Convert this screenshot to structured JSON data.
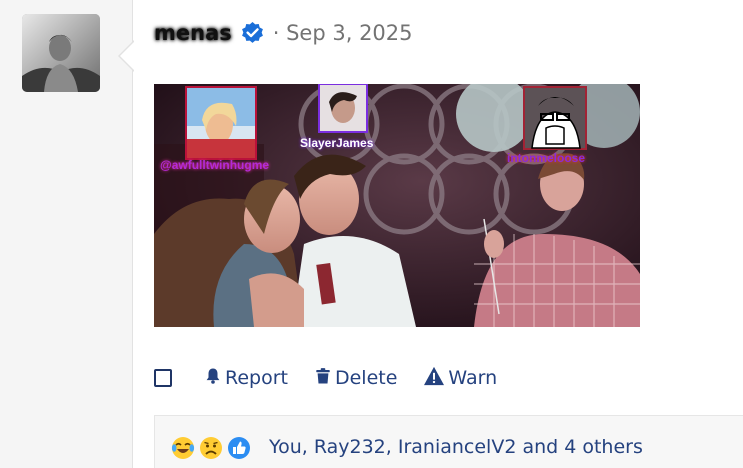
{
  "post": {
    "username": "menas",
    "date": "· Sep 3, 2025"
  },
  "image_tags": {
    "tag1": "@awfulltwinhugme",
    "tag2": "SlayerJames",
    "tag3": "intonmeloose"
  },
  "actions": {
    "report_label": "Report",
    "delete_label": "Delete",
    "warn_label": "Warn"
  },
  "reactions": {
    "summary": "You, Ray232, IraniancelV2 and 4 others",
    "icons": [
      "laughing-crying-icon",
      "sad-face-icon",
      "like-thumb-icon"
    ]
  },
  "colors": {
    "link": "#25427f",
    "verified": "#1a6ed8",
    "date": "#737373"
  }
}
